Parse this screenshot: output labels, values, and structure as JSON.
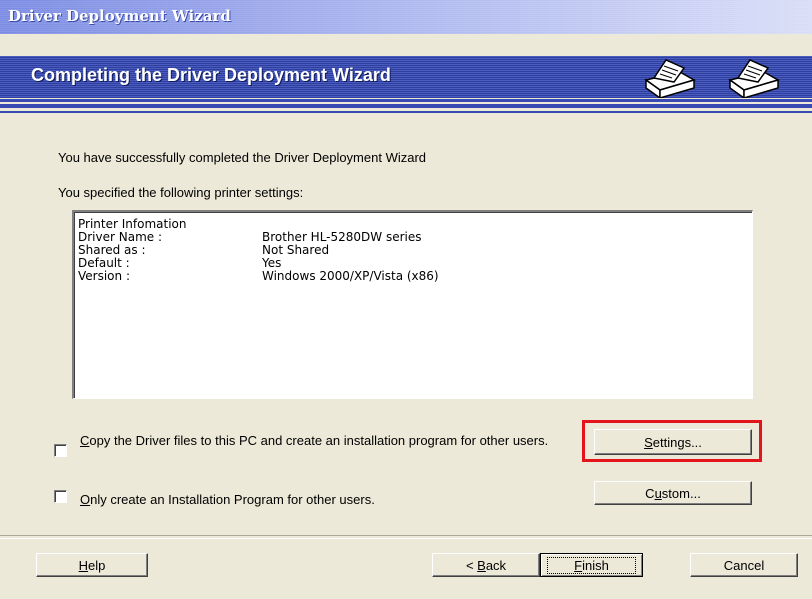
{
  "window": {
    "title": "Driver Deployment Wizard"
  },
  "header": {
    "title": "Completing the Driver Deployment Wizard"
  },
  "messages": {
    "success": "You have successfully completed the Driver Deployment Wizard",
    "specified": "You specified the following printer settings:"
  },
  "printer_info": {
    "header": "Printer Infomation",
    "rows": [
      {
        "label": "Driver Name :",
        "value": "Brother HL-5280DW series"
      },
      {
        "label": "Shared as :",
        "value": "Not Shared"
      },
      {
        "label": "Default :",
        "value": "Yes"
      },
      {
        "label": "Version :",
        "value": "Windows 2000/XP/Vista (x86)"
      }
    ]
  },
  "options": {
    "copy_driver": {
      "mnemonic": "C",
      "rest": "opy the Driver files to this PC and create an installation program for other users.",
      "checked": false
    },
    "only_install": {
      "mnemonic": "O",
      "rest": "nly create an Installation Program for other users.",
      "checked": false
    }
  },
  "buttons": {
    "settings": {
      "mnemonic": "S",
      "rest": "ettings..."
    },
    "custom": {
      "prefix": "C",
      "mnemonic": "u",
      "rest": "stom..."
    },
    "help": {
      "mnemonic": "H",
      "rest": "elp"
    },
    "back": {
      "prefix": "< ",
      "mnemonic": "B",
      "rest": "ack"
    },
    "finish": {
      "mnemonic": "F",
      "rest": "inish"
    },
    "cancel": "Cancel"
  },
  "colors": {
    "highlight_border": "#e3141b",
    "banner_blue": "#3a4ab5"
  },
  "icons": [
    "printer-icon",
    "printer-icon"
  ]
}
